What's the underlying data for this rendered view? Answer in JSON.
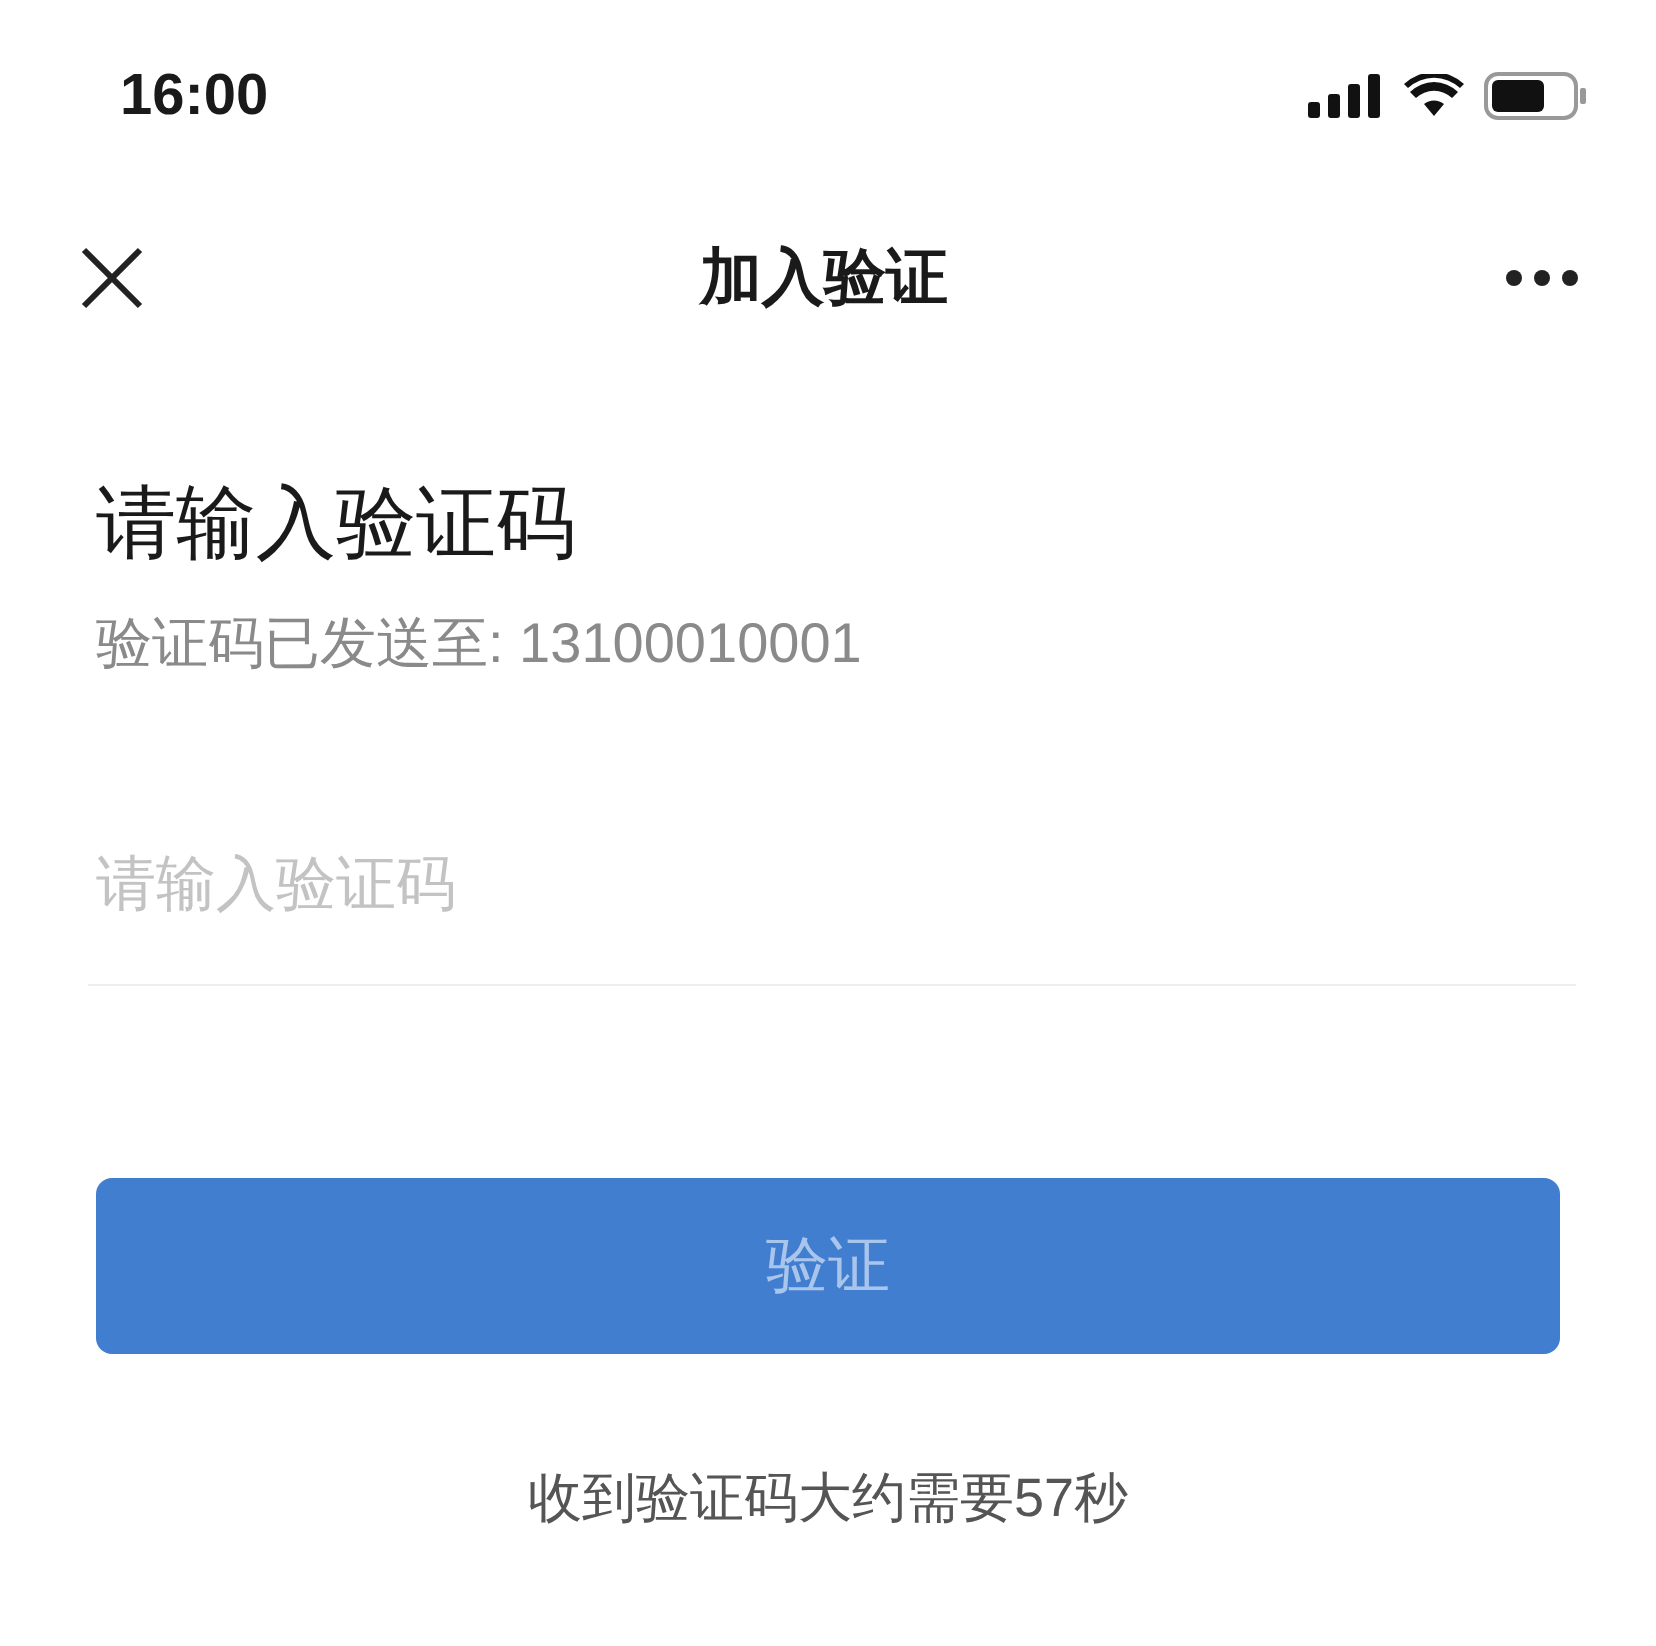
{
  "status_bar": {
    "time": "16:00"
  },
  "nav_bar": {
    "title": "加入验证"
  },
  "heading": "请输入验证码",
  "subtitle": "验证码已发送至: 13100010001",
  "code_field": {
    "placeholder": "请输入验证码"
  },
  "verify_button": {
    "label": "验证",
    "disabled": true
  },
  "countdown": "收到验证码大约需要57秒"
}
